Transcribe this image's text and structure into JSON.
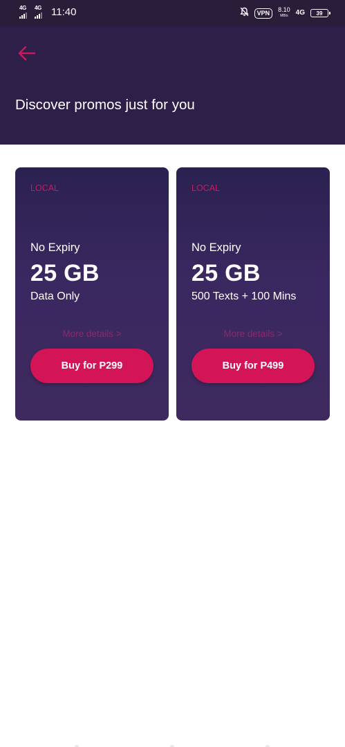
{
  "status_bar": {
    "network_1": "4G",
    "network_2": "4G",
    "time": "11:40",
    "vpn": "VPN",
    "speed": "8.10",
    "speed_unit": "MB/s",
    "network_3": "4G",
    "battery": "39",
    "icons": [
      "signal-icon",
      "signal-icon",
      "notifications-off-icon",
      "vpn-icon",
      "data-speed-icon",
      "mobile-data-icon",
      "battery-icon"
    ]
  },
  "header": {
    "back_icon": "arrow-left-icon",
    "title": "Discover promos just for you"
  },
  "promos": [
    {
      "category": "LOCAL",
      "validity": "No Expiry",
      "amount": "25 GB",
      "description": "Data Only",
      "more_details": "More details >",
      "buy_label": "Buy for P299"
    },
    {
      "category": "LOCAL",
      "validity": "No Expiry",
      "amount": "25 GB",
      "description": "500 Texts + 100 Mins",
      "more_details": "More details >",
      "buy_label": "Buy for P499"
    }
  ],
  "colors": {
    "header_bg": "#2d1f47",
    "accent": "#d31457",
    "card_bg": "#3a2860",
    "category_text": "#c81960",
    "link_text": "#8a2a6a"
  }
}
